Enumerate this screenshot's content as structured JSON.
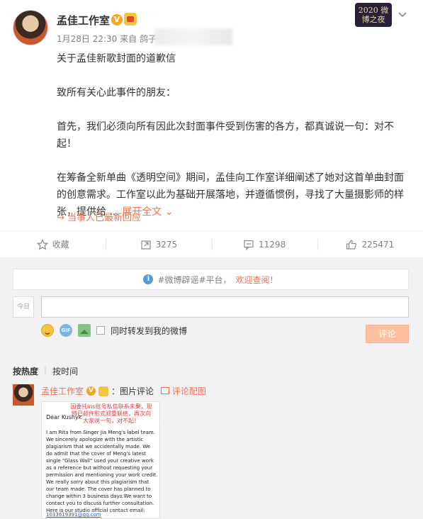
{
  "post": {
    "username": "孟佳工作室",
    "verified_mark": "V",
    "time": "1月28日 22:30",
    "source_prefix": "来自",
    "source_visible": "鸽子",
    "event_badge": "2020 微博之夜",
    "content": {
      "title": "关于孟佳新歌封面的道歉信",
      "salutation": "致所有关心此事件的朋友：",
      "para1": "首先，我们必须向所有因此次封面事件受到伤害的各方，都真诚说一句：对不起！",
      "para2": "在筹备全新单曲《透明空间》期间，孟佳向工作室详细阐述了她对这首单曲封面的创意需求。工作室以此为基础开展落地，并遵循惯例，寻找了大量摄影师的样张，提供给 ...",
      "expand": "展开全文 ⌄"
    },
    "reply_note": "当事人已最新回应",
    "icons": {
      "more": "chevron-down-icon",
      "reply": "reply-arrow-icon"
    }
  },
  "actions": {
    "favorite": {
      "label": "收藏",
      "icon": "star-icon"
    },
    "repost": {
      "count": "3275",
      "icon": "repost-icon"
    },
    "comment": {
      "count": "11298",
      "icon": "comment-icon"
    },
    "like": {
      "count": "225471",
      "icon": "thumbs-up-icon"
    }
  },
  "notice": {
    "text": "#微博辟谣#平台，",
    "welcome": "欢迎查阅！",
    "icon": "info-icon"
  },
  "composer": {
    "avatar_text": "今日",
    "input_value": "",
    "repost_checkbox_label": "同时转发到我的微博",
    "submit_label": "评论",
    "icons": [
      "emoji-icon",
      "gif-icon",
      "image-icon"
    ]
  },
  "sort": {
    "hot": "按热度",
    "time": "按时间"
  },
  "comment": {
    "username": "孟佳工作室",
    "verified_mark": "V",
    "text": "：图片评论",
    "link": "评论配图",
    "attachment": {
      "red_note": "因委托ins账号私信联系未果，现特已邮件形式郑重联络，再次向大家说一句，对不起！",
      "greeting": "Dear Kushyk",
      "body": "I am Rita from Singer Jia Meng's label team. We sincerely apologize with the artistic plagiarism that we accidentally made. We do admit that the cover of Meng's latest single \"Glass Wall\" used your creative work as a reference but without requesting your permission and mentioning your work credit. We really sorry about this plagiarism that our team made. The cover has planned to change within 3 business days.We want to contact you to discuss further consultation. Here is our studio official contact email:",
      "email": "1033619391@qq.com"
    }
  },
  "colors": {
    "accent": "#eb7350",
    "background": "#f2f2f5",
    "verified": "#f6a623"
  }
}
